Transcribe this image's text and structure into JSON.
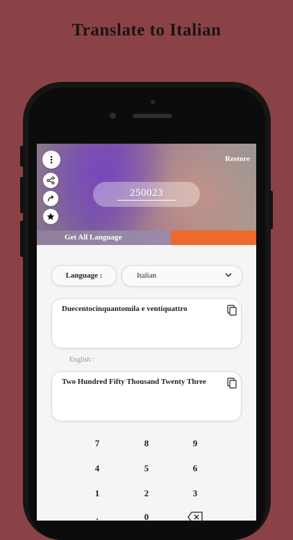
{
  "headline": "Translate to Italian",
  "header": {
    "restore_label": "Restore",
    "number_value": "250023",
    "icons": [
      "more-vertical-icon",
      "share-icon",
      "redo-icon",
      "star-icon"
    ]
  },
  "lang_bar": {
    "label": "Get All Language",
    "accent_color": "#ee6a2a"
  },
  "language": {
    "label": "Language :",
    "selected": "Italian"
  },
  "translation": {
    "italian_text": "Duecentocinquantomila e ventiquattro",
    "english_label": "English :",
    "english_text": "Two Hundred Fifty Thousand Twenty Three"
  },
  "keypad": {
    "rows": [
      [
        "7",
        "8",
        "9"
      ],
      [
        "4",
        "5",
        "6"
      ],
      [
        "1",
        "2",
        "3"
      ],
      [
        ".",
        "0"
      ]
    ]
  },
  "colors": {
    "background": "#8b4246",
    "screen": "#f6f4f4"
  }
}
